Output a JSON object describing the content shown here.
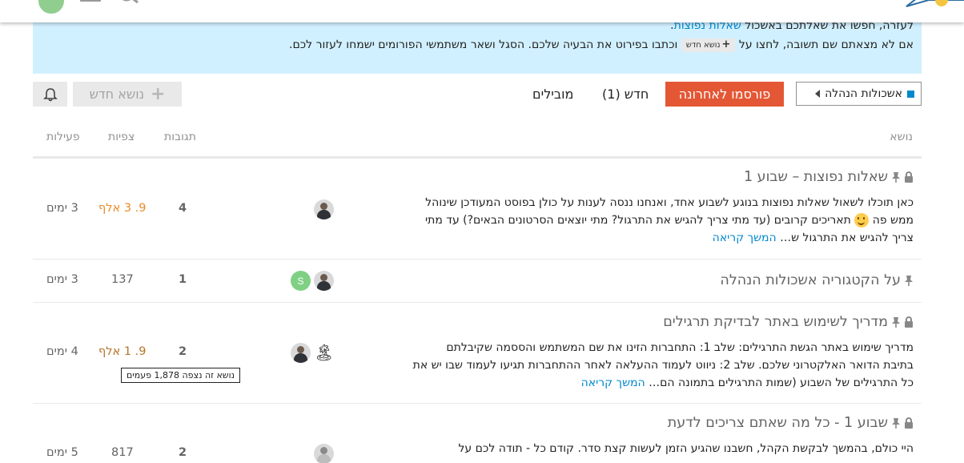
{
  "banner": {
    "line1_prefix": "לעזרה, חפשו את שאלתכם באשכול",
    "line1_link": "שאלות נפוצות",
    "line2_prefix": "אם לא מצאתם שם תשובה, לחצו על",
    "line2_button": "נושא חדש",
    "line2_suffix": "וכתבו בפירוט את הבעיה שלכם. הסגל ושאר משתמשי הפורומים ישמחו לעזור לכם."
  },
  "toolbar": {
    "category": "אשכולות הנהלה",
    "nav": [
      "פורסמו לאחרונה",
      "חדש (1)",
      "מובילים"
    ],
    "new_topic": "נושא חדש"
  },
  "table_head": {
    "topic": "נושא",
    "replies": "תגובות",
    "views": "צפיות",
    "activity": "פעילות"
  },
  "topics": [
    {
      "title": "שאלות נפוצות – שבוע 1",
      "excerpt_lines": [
        "כאן תוכלו לשאול שאלות נפוצות בנוגע לשבוע אחד, ואנחנו ננסה לענות על כולן בפוסט המעודכן שינוהל",
        "ממש פה",
        "תאריכים קרובים (עד מתי צריך להגיש את התרגול? מתי יוצאים הסרטונים הבאים?) עד מתי",
        "צריך להגיש את התרגול ש…"
      ],
      "read_more": "המשך קריאה",
      "replies": "4",
      "views": "9. 3 אלף",
      "activity": "3 ימים"
    },
    {
      "title": "על הקטגוריה אשכולות הנהלה",
      "poster_letter": "S",
      "replies": "1",
      "views": "137",
      "activity": "3 ימים"
    },
    {
      "title": "מדריך לשימוש באתר לבדיקת תרגילים",
      "excerpt_lines": [
        "מדריך שימוש באתר הגשת התרגילים: שלב 1: התחברות הזינו את שם המשתמש והססמה שקיבלתם",
        "בתיבת הדואר האלקטרוני שלכם. שלב 2: ניווט לעמוד ההעלאה לאחר ההתחברות תגיעו לעמוד שבו יש את",
        "כל התרגילים של השבוע (שמות התרגילים בתמונה הם…"
      ],
      "read_more": "המשך קריאה",
      "replies": "2",
      "views": "9. 1 אלף",
      "views_tooltip": "נושא זה נצפה 1,878 פעמים",
      "activity": "4 ימים"
    },
    {
      "title": "שבוע 1 - כל מה שאתם צריכים לדעת",
      "excerpt_lines": [
        "היי כולם, בהמשך לבקשת הקהל, חשבנו שהגיע הזמן לעשות קצת סדר. קודם כל - תודה לכם על"
      ],
      "replies": "2",
      "views": "817",
      "activity": "5 ימים"
    }
  ],
  "colors": {
    "accent": "#e45735",
    "link": "#0088cc",
    "banner_bg": "#d1f0ff",
    "hot_views": "#e98b2a"
  },
  "icons": [
    "lock-icon",
    "pin-icon",
    "bell-icon",
    "plus-icon",
    "caret-left-icon",
    "search-icon",
    "menu-icon"
  ]
}
